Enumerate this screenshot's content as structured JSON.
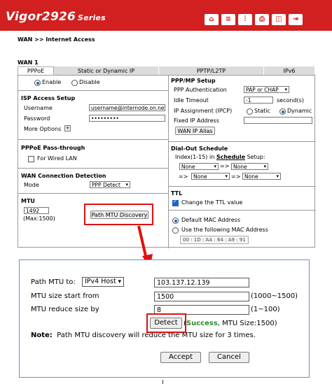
{
  "app": {
    "brand": "Vigor2926",
    "series": "Series"
  },
  "topbar_icons": [
    "home-icon",
    "menu-icon",
    "settings-icon",
    "print-icon",
    "book-icon",
    "logout-icon"
  ],
  "breadcrumb": "WAN >> Internet Access",
  "wan_title": "WAN 1",
  "tabs": [
    "PPPoE",
    "Static or Dynamic IP",
    "PPTP/L2TP",
    "IPv6"
  ],
  "left": {
    "enable": "Enable",
    "disable": "Disable",
    "isp_title": "ISP Access Setup",
    "username_label": "Username",
    "username_value": "username@internode.on.net",
    "password_label": "Password",
    "password_value": "•••••••••",
    "more_options": "More Options",
    "passthrough_title": "PPPoE Pass-through",
    "wired_lan": "For Wired LAN",
    "detection_title": "WAN Connection Detection",
    "mode_label": "Mode",
    "mode_value": "PPP Detect",
    "mtu_title": "MTU",
    "mtu_value": "1492",
    "mtu_max": "(Max:1500)",
    "path_mtu_button": "Path MTU Discovery"
  },
  "right": {
    "ppp_title": "PPP/MP Setup",
    "auth_label": "PPP Authentication",
    "auth_value": "PAP or CHAP",
    "idle_label": "Idle Timeout",
    "idle_value": "-1",
    "idle_unit": "second(s)",
    "ip_assign_label": "IP Assignment (IPCP)",
    "static": "Static",
    "dynamic": "Dynamic",
    "fixed_ip_label": "Fixed IP Address",
    "wan_ip_alias": "WAN IP Alias",
    "dialout_title": "Dial-Out Schedule",
    "index_text_a": "Index(1-15) in ",
    "index_link": "Schedule",
    "index_text_b": " Setup:",
    "none": "None",
    "arrow": "=>",
    "ttl_title": "TTL",
    "ttl_change": "Change the TTL value",
    "default_mac": "Default MAC Address",
    "following_mac": "Use the following MAC Address",
    "mac": [
      "00",
      "1D",
      "AA",
      "64",
      "A9",
      "91"
    ]
  },
  "dialog": {
    "path_mtu_label": "Path MTU to:",
    "ip_type": "IPv4 Host",
    "host_value": "103.137.12.139",
    "start_label": "MTU size start from",
    "start_value": "1500",
    "start_range": "(1000~1500)",
    "reduce_label": "MTU reduce size by",
    "reduce_value": "8",
    "reduce_range": "(1~100)",
    "detect_button": "Detect",
    "result_open": "(",
    "result_success": "Success",
    "result_rest": ", MTU Size:1500)",
    "note_label": "Note:",
    "note_text": "Path MTU discovery will reduce the MTU size for 3 times.",
    "accept": "Accept",
    "cancel": "Cancel"
  },
  "colors": {
    "brand": "#d21f1f",
    "highlight": "#e01010",
    "success": "#2e8b2e"
  }
}
